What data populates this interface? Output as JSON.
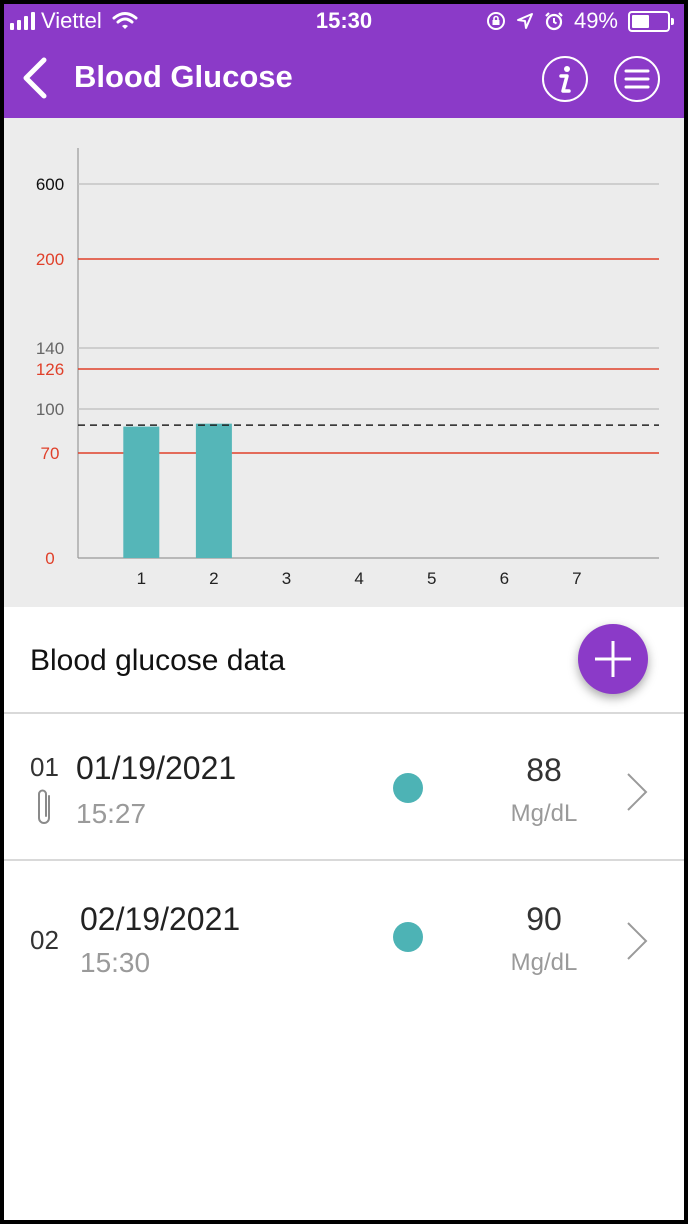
{
  "status_bar": {
    "carrier": "Viettel",
    "time": "15:30",
    "battery": "49%",
    "battery_level": 0.49,
    "icons": [
      "signal-icon",
      "wifi-icon",
      "orientation-lock-icon",
      "location-icon",
      "alarm-icon",
      "battery-icon"
    ]
  },
  "header": {
    "title": "Blood Glucose",
    "background": "#8b3ac8",
    "icons": [
      "back-icon",
      "info-icon",
      "menu-icon"
    ]
  },
  "chart_data": {
    "type": "bar",
    "categories": [
      "1",
      "2",
      "3",
      "4",
      "5",
      "6",
      "7"
    ],
    "values": [
      88,
      90,
      null,
      null,
      null,
      null,
      null
    ],
    "bar_color": "#55b6b8",
    "y_ticks": [
      {
        "value": 0,
        "label": "0",
        "color": "#e0402a"
      },
      {
        "value": 70,
        "label": "70",
        "color": "#e0402a"
      },
      {
        "value": 100,
        "label": "100",
        "color": "#666666"
      },
      {
        "value": 126,
        "label": "126",
        "color": "#e0402a"
      },
      {
        "value": 140,
        "label": "140",
        "color": "#666666"
      },
      {
        "value": 200,
        "label": "200",
        "color": "#e0402a"
      },
      {
        "value": 600,
        "label": "600",
        "color": "#111111"
      }
    ],
    "gridlines": [
      {
        "value": 70,
        "color": "#e0402a"
      },
      {
        "value": 100,
        "color": "#c4c4c4"
      },
      {
        "value": 126,
        "color": "#e0402a"
      },
      {
        "value": 140,
        "color": "#c4c4c4"
      },
      {
        "value": 200,
        "color": "#e0402a"
      },
      {
        "value": 600,
        "color": "#c4c4c4"
      }
    ],
    "dashed_line": 89,
    "xlabel": "",
    "ylabel": ""
  },
  "list": {
    "title": "Blood glucose data",
    "add_icon": "plus-icon",
    "records": [
      {
        "index": "01",
        "date": "01/19/2021",
        "time": "15:27",
        "value": "88",
        "unit": "Mg/dL",
        "dot_color": "#4db3b5",
        "has_attachment": true
      },
      {
        "index": "02",
        "date": "02/19/2021",
        "time": "15:30",
        "value": "90",
        "unit": "Mg/dL",
        "dot_color": "#4db3b5",
        "has_attachment": false
      }
    ]
  }
}
